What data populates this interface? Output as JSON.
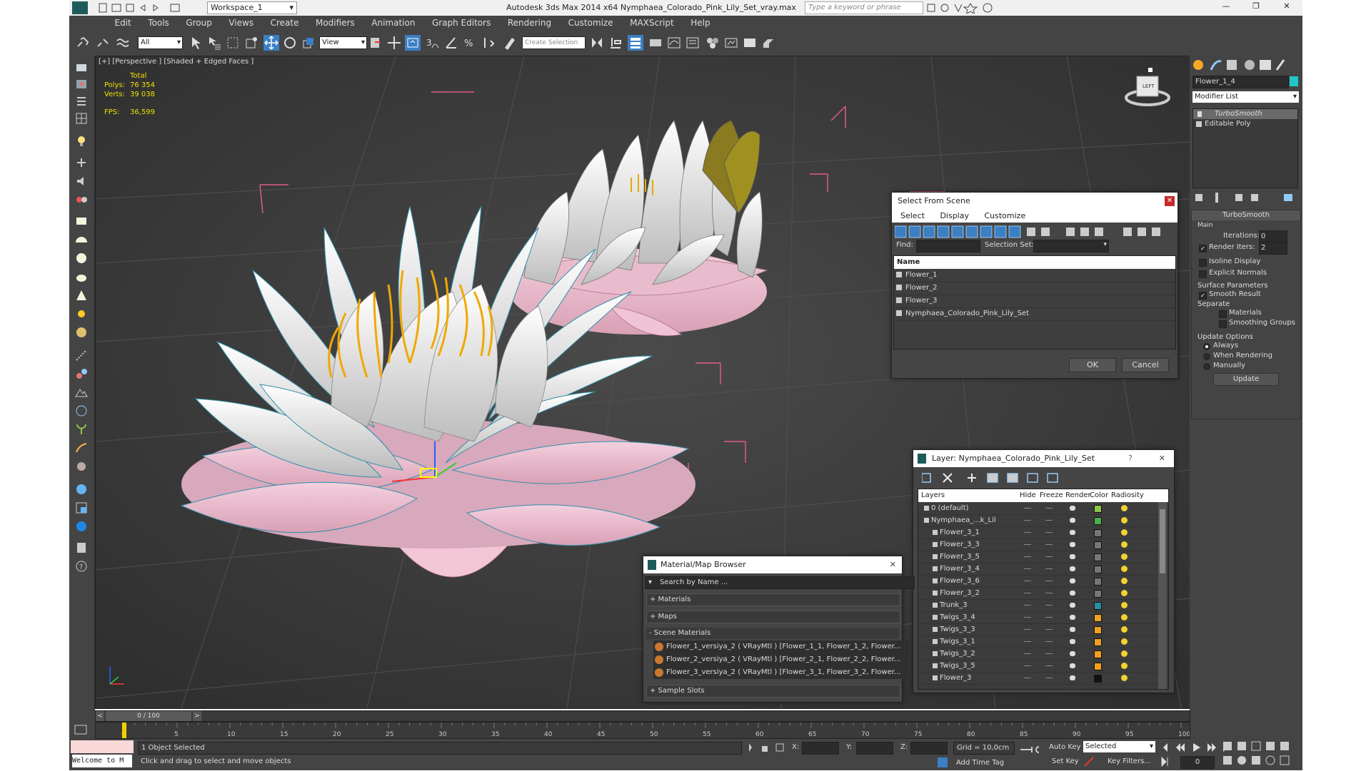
{
  "title": "Autodesk 3ds Max  2014 x64     Nymphaea_Colorado_Pink_Lily_Set_vray.max",
  "workspace": "Workspace_1",
  "search_placeholder": "Type a keyword or phrase",
  "menu": [
    "Edit",
    "Tools",
    "Group",
    "Views",
    "Create",
    "Modifiers",
    "Animation",
    "Graph Editors",
    "Rendering",
    "Customize",
    "MAXScript",
    "Help"
  ],
  "toolbar": {
    "filter": "All",
    "ref_coord": "View",
    "sel_set": "Create Selection Se"
  },
  "viewport": {
    "label": "[+] [Perspective ] [Shaded + Edged Faces ]",
    "stats_total": "Total",
    "polys_label": "Polys:",
    "polys": "76 354",
    "verts_label": "Verts:",
    "verts": "39 038",
    "fps_label": "FPS:",
    "fps": "36,599",
    "viewcube": "LEFT"
  },
  "select_scene": {
    "title": "Select From Scene",
    "menu": [
      "Select",
      "Display",
      "Customize"
    ],
    "find_label": "Find:",
    "selset_label": "Selection Set:",
    "col_name": "Name",
    "items": [
      "Flower_1",
      "Flower_2",
      "Flower_3",
      "Nymphaea_Colorado_Pink_Lily_Set"
    ],
    "ok": "OK",
    "cancel": "Cancel"
  },
  "layer": {
    "title": "Layer: Nymphaea_Colorado_Pink_Lily_Set",
    "cols": [
      "Layers",
      "Hide",
      "Freeze",
      "Render",
      "Color",
      "Radiosity"
    ],
    "rows": [
      {
        "name": "0 (default)",
        "color": "#8bc34a"
      },
      {
        "name": "Nymphaea_...k_Lil",
        "color": "#4caf50"
      },
      {
        "name": "Flower_3_1",
        "color": "#777777"
      },
      {
        "name": "Flower_3_3",
        "color": "#777777"
      },
      {
        "name": "Flower_3_5",
        "color": "#777777"
      },
      {
        "name": "Flower_3_4",
        "color": "#777777"
      },
      {
        "name": "Flower_3_6",
        "color": "#777777"
      },
      {
        "name": "Flower_3_2",
        "color": "#777777"
      },
      {
        "name": "Trunk_3",
        "color": "#2a8fa0"
      },
      {
        "name": "Twigs_3_4",
        "color": "#f0a020"
      },
      {
        "name": "Twigs_3_3",
        "color": "#f0a020"
      },
      {
        "name": "Twigs_3_1",
        "color": "#f0a020"
      },
      {
        "name": "Twigs_3_2",
        "color": "#f0a020"
      },
      {
        "name": "Twigs_3_5",
        "color": "#f0a020"
      },
      {
        "name": "Flower_3",
        "color": "#111111"
      }
    ]
  },
  "material": {
    "title": "Material/Map Browser",
    "search": "Search by Name ...",
    "materials": "+ Materials",
    "maps": "+ Maps",
    "scene_materials": "- Scene Materials",
    "items": [
      "Flower_1_versiya_2  ( VRayMtl )  [Flower_1_1, Flower_1_2, Flower...",
      "Flower_2_versiya_2  ( VRayMtl )  [Flower_2_1, Flower_2_2, Flower...",
      "Flower_3_versiya_2  ( VRayMtl )  [Flower_3_1, Flower_3_2, Flower..."
    ],
    "sample_slots": "+ Sample Slots"
  },
  "command_panel": {
    "object_name": "Flower_1_4",
    "modifier_list": "Modifier List",
    "stack": [
      "TurboSmooth",
      "Editable Poly"
    ],
    "rollout": "TurboSmooth",
    "main": "Main",
    "iterations_label": "Iterations:",
    "iterations": "0",
    "render_iters_label": "Render Iters:",
    "render_iters": "2",
    "isoline": "Isoline Display",
    "explicit": "Explicit Normals",
    "surface_params": "Surface Parameters",
    "smooth_result": "Smooth Result",
    "separate": "Separate",
    "materials": "Materials",
    "smoothing_groups": "Smoothing Groups",
    "update_options": "Update Options",
    "always": "Always",
    "when_rendering": "When Rendering",
    "manually": "Manually",
    "update": "Update"
  },
  "timeline": {
    "frame": "0 / 100",
    "ticks": [
      "0",
      "5",
      "10",
      "15",
      "20",
      "25",
      "30",
      "35",
      "40",
      "45",
      "50",
      "55",
      "60",
      "65",
      "70",
      "75",
      "80",
      "85",
      "90",
      "95",
      "100"
    ]
  },
  "status": {
    "welcome": "Welcome to M",
    "selected": "1 Object Selected",
    "prompt": "Click and drag to select and move objects",
    "x": "X:",
    "y": "Y:",
    "z": "Z:",
    "grid": "Grid = 10,0cm",
    "add_time_tag": "Add Time Tag",
    "auto_key": "Auto Key",
    "set_key": "Set Key",
    "selected_dd": "Selected",
    "key_filters": "Key Filters...",
    "frame_field": "0"
  }
}
